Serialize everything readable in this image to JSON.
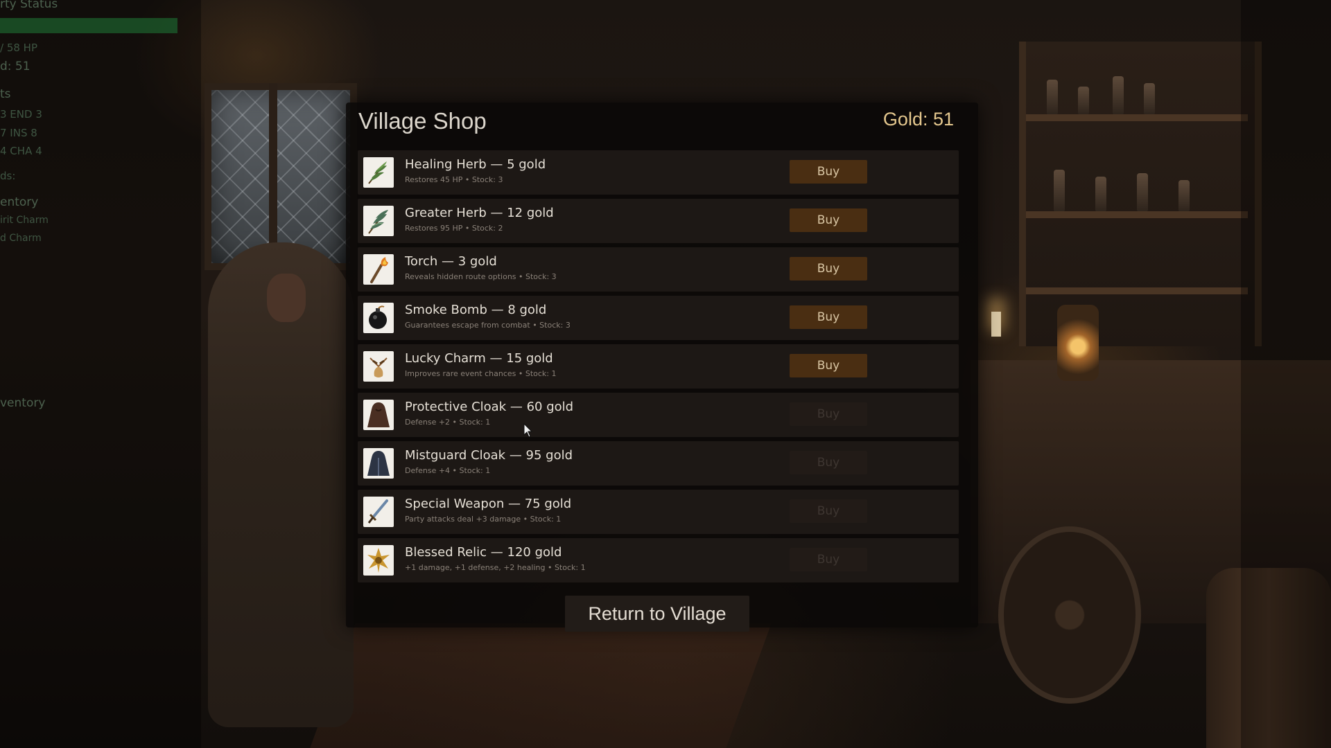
{
  "side_panel": {
    "heading": "rty Status",
    "hp": "/ 58 HP",
    "gold": "d: 51",
    "stats_heading": "ts",
    "stat_row_1": "3  END 3",
    "stat_row_2": "7  INS 8",
    "stat_row_3": "4  CHA 4",
    "bonds": "ds:",
    "inventory_heading": "entory",
    "inventory_items": [
      "irit Charm",
      "d Charm"
    ],
    "inventory_heading_2": "ventory"
  },
  "shop": {
    "title": "Village Shop",
    "gold": "Gold: 51",
    "buy_label": "Buy",
    "return_label": "Return to Village",
    "items": [
      {
        "name": "Healing Herb — 5 gold",
        "desc": "Restores 45 HP  •  Stock: 3",
        "icon": "herb-icon",
        "affordable": true
      },
      {
        "name": "Greater Herb — 12 gold",
        "desc": "Restores 95 HP  •  Stock: 2",
        "icon": "greater-herb-icon",
        "affordable": true
      },
      {
        "name": "Torch — 3 gold",
        "desc": "Reveals hidden route options  •  Stock: 3",
        "icon": "torch-icon",
        "affordable": true
      },
      {
        "name": "Smoke Bomb — 8 gold",
        "desc": "Guarantees escape from combat  •  Stock: 3",
        "icon": "bomb-icon",
        "affordable": true
      },
      {
        "name": "Lucky Charm — 15 gold",
        "desc": "Improves rare event chances  •  Stock: 1",
        "icon": "charm-icon",
        "affordable": true
      },
      {
        "name": "Protective Cloak — 60 gold",
        "desc": "Defense +2  •  Stock: 1",
        "icon": "cloak-icon",
        "affordable": false
      },
      {
        "name": "Mistguard Cloak — 95 gold",
        "desc": "Defense +4  •  Stock: 1",
        "icon": "mist-cloak-icon",
        "affordable": false
      },
      {
        "name": "Special Weapon — 75 gold",
        "desc": "Party attacks deal +3 damage  •  Stock: 1",
        "icon": "sword-icon",
        "affordable": false
      },
      {
        "name": "Blessed Relic — 120 gold",
        "desc": "+1 damage, +1 defense, +2 healing  •  Stock: 1",
        "icon": "relic-icon",
        "affordable": false
      }
    ]
  },
  "colors": {
    "buy_enabled": "#4a2e12",
    "buy_disabled": "#221b17",
    "gold_text": "#e6c98f",
    "hp_bar": "#1c5e2c"
  }
}
